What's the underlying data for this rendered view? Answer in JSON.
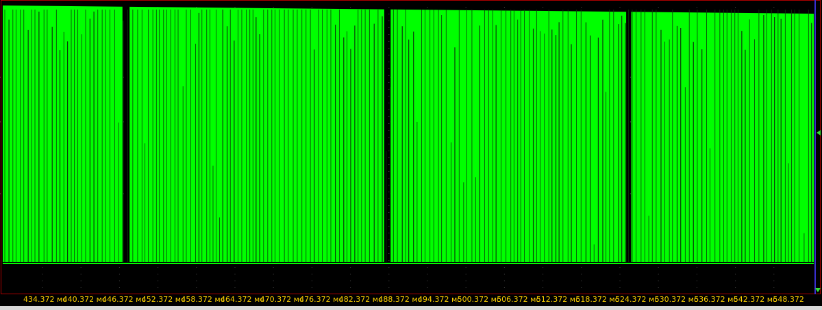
{
  "chart_data": {
    "type": "line",
    "xlabel": "",
    "ylabel": "",
    "x_unit": "мс",
    "x_ticks": [
      "434.372 мс",
      "440.372 мс",
      "446.372 мс",
      "452.372 мс",
      "458.372 мс",
      "464.372 мс",
      "470.372 мс",
      "476.372 мс",
      "482.372 мс",
      "488.372 мс",
      "494.372 мс",
      "500.372 мс",
      "506.372 мс",
      "512.372 мс",
      "518.372 мс",
      "524.372 мс",
      "530.372 мс",
      "536.372 мс",
      "542.372 мс",
      "548.372"
    ],
    "xlim": [
      434.372,
      548.372
    ],
    "ylim": [
      0,
      1
    ],
    "grid": true,
    "series": [
      {
        "color": "#00ff00",
        "high_level": 1,
        "low_level": 0,
        "gaps_ms": [
          [
            451.2,
            452.2
          ],
          [
            488.0,
            488.9
          ],
          [
            522.0,
            522.7
          ]
        ]
      }
    ]
  },
  "colors": {
    "trace": "#00ff00",
    "background": "#000000",
    "tick_text": "#ffd200",
    "frame": "#b00000",
    "marker": "#35e035"
  }
}
